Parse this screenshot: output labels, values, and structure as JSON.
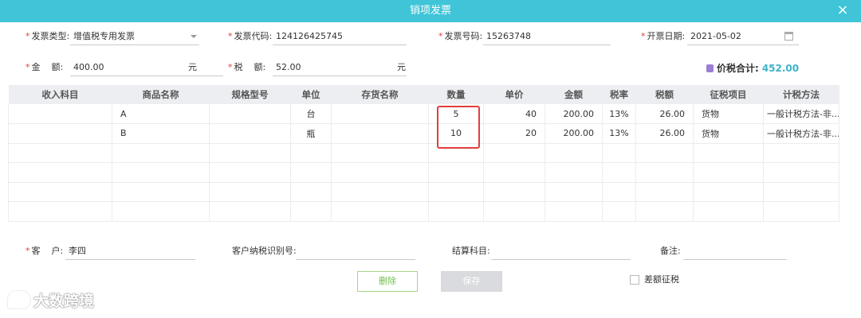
{
  "dialog": {
    "title": "销项发票",
    "close_icon": "×"
  },
  "form": {
    "invoice_type": {
      "label": "发票类型:",
      "value": "增值税专用发票"
    },
    "invoice_code": {
      "label": "发票代码:",
      "value": "124126425745"
    },
    "invoice_number": {
      "label": "发票号码:",
      "value": "15263748"
    },
    "issue_date": {
      "label": "开票日期:",
      "value": "2021-05-02"
    },
    "amount": {
      "label": "金    额:",
      "value": "400.00",
      "suffix": "元"
    },
    "tax": {
      "label": "税    额:",
      "value": "52.00",
      "suffix": "元"
    },
    "total": {
      "label": "价税合计:",
      "value": "452.00"
    }
  },
  "table": {
    "headers": [
      "收入科目",
      "商品名称",
      "规格型号",
      "单位",
      "存货名称",
      "数量",
      "单价",
      "金额",
      "税率",
      "税额",
      "征税项目",
      "计税方法"
    ],
    "rows": [
      [
        "",
        "A",
        "",
        "台",
        "",
        "5",
        "40",
        "200.00",
        "13%",
        "26.00",
        "货物",
        "一般计税方法-非..."
      ],
      [
        "",
        "B",
        "",
        "瓶",
        "",
        "10",
        "20",
        "200.00",
        "13%",
        "26.00",
        "货物",
        "一般计税方法-非..."
      ]
    ]
  },
  "footer": {
    "customer": {
      "label": "客    户:",
      "value": "李四"
    },
    "tax_id": {
      "label": "客户纳税识别号:",
      "value": ""
    },
    "settle_account": {
      "label": "结算科目:",
      "value": ""
    },
    "remark": {
      "label": "备注:",
      "value": ""
    },
    "delete_label": "删除",
    "save_label": "保存",
    "diff_tax_label": "差额征税"
  },
  "watermark": "大数跨境",
  "colors": {
    "titlebar": "#3fc4d8",
    "total_amount": "#3fb3c8",
    "highlight": "#e23d3d",
    "delete_button": "#6fbf4a"
  }
}
